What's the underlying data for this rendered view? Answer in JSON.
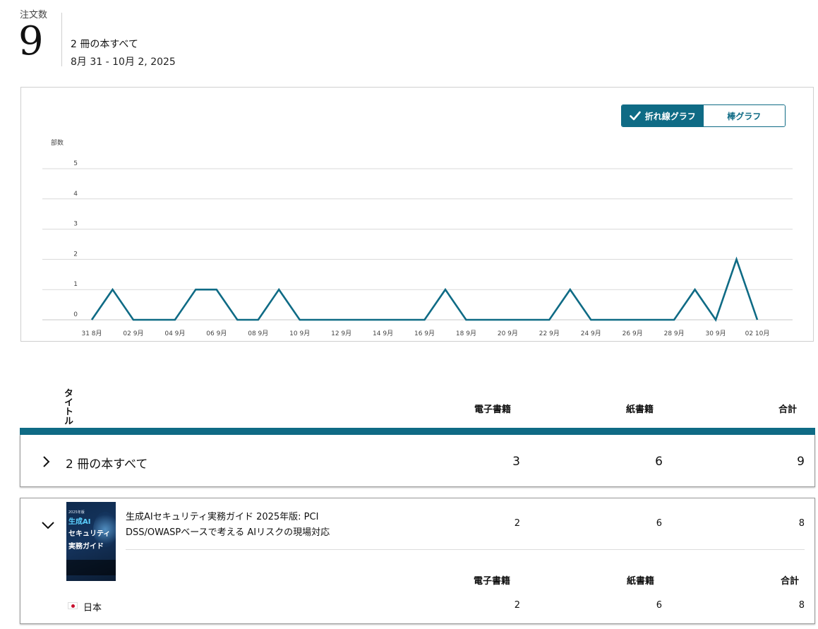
{
  "header": {
    "orders_label": "注文数",
    "orders_count": "9",
    "books_label": "2 冊の本すべて",
    "date_range": "8月 31 - 10月 2, 2025"
  },
  "chart_toggle": {
    "line_label": "折れ線グラフ",
    "bar_label": "棒グラフ",
    "active": "line"
  },
  "colors": {
    "accent": "#0f6b85",
    "grid": "#d9d9d9"
  },
  "chart_data": {
    "type": "line",
    "ylabel": "部数",
    "ylim": [
      0,
      5
    ],
    "yticks": [
      0,
      1,
      2,
      3,
      4,
      5
    ],
    "x_tick_labels": [
      "31 8月",
      "02 9月",
      "04 9月",
      "06 9月",
      "08 9月",
      "10 9月",
      "12 9月",
      "14 9月",
      "16 9月",
      "18 9月",
      "20 9月",
      "22 9月",
      "24 9月",
      "26 9月",
      "28 9月",
      "30 9月",
      "02 10月"
    ],
    "x": [
      "2025-08-31",
      "2025-09-01",
      "2025-09-02",
      "2025-09-03",
      "2025-09-04",
      "2025-09-05",
      "2025-09-06",
      "2025-09-07",
      "2025-09-08",
      "2025-09-09",
      "2025-09-10",
      "2025-09-11",
      "2025-09-12",
      "2025-09-13",
      "2025-09-14",
      "2025-09-15",
      "2025-09-16",
      "2025-09-17",
      "2025-09-18",
      "2025-09-19",
      "2025-09-20",
      "2025-09-21",
      "2025-09-22",
      "2025-09-23",
      "2025-09-24",
      "2025-09-25",
      "2025-09-26",
      "2025-09-27",
      "2025-09-28",
      "2025-09-29",
      "2025-09-30",
      "2025-10-01",
      "2025-10-02"
    ],
    "series": [
      {
        "values": [
          0,
          1,
          0,
          0,
          0,
          1,
          1,
          0,
          0,
          1,
          0,
          0,
          0,
          0,
          0,
          0,
          0,
          1,
          0,
          0,
          0,
          0,
          0,
          1,
          0,
          0,
          0,
          0,
          0,
          1,
          0,
          2,
          0
        ]
      }
    ],
    "grid": true,
    "legend": "none"
  },
  "table": {
    "headers": {
      "title": "タイトル",
      "ebook": "電子書籍",
      "paper": "紙書籍",
      "total": "合計"
    },
    "summary_row": {
      "label": "2 冊の本すべて",
      "ebook": "3",
      "paper": "6",
      "total": "9"
    },
    "book": {
      "title": "生成AIセキュリティ実務ガイド 2025年版: PCI DSS/OWASPベースで考える AIリスクの現場対応",
      "ebook": "2",
      "paper": "6",
      "total": "8",
      "cover": {
        "line1": "2025年版",
        "line2": "生成AI",
        "line3": "セキュリティ",
        "line4": "実務ガイド"
      },
      "marketplace_headers": {
        "ebook": "電子書籍",
        "paper": "紙書籍",
        "total": "合計"
      },
      "marketplace": {
        "country": "日本",
        "ebook": "2",
        "paper": "6",
        "total": "8"
      }
    }
  }
}
